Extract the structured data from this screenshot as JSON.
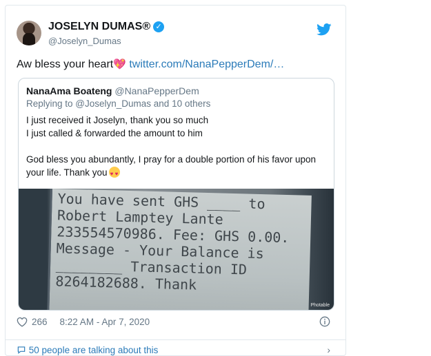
{
  "author": {
    "name": "JOSELYN DUMAS®",
    "handle": "@Joselyn_Dumas"
  },
  "tweet": {
    "text": "Aw bless your heart",
    "emoji": "sparkling-heart",
    "link": "twitter.com/NanaPepperDem/…"
  },
  "quote": {
    "name": "NanaAma Boateng",
    "handle": "@NanaPepperDem",
    "replying_to": "Replying to @Joselyn_Dumas and 10 others",
    "lines": [
      "I just received it Joselyn, thank you so much",
      "I just called & forwarded the amount to him",
      "God bless you abundantly, I pray for a double portion of his favor upon your life. Thank you"
    ],
    "photo_text": [
      "You have sent GHS ____ to",
      "Robert Lamptey Lante",
      "233554570986. Fee: GHS 0.00.",
      "Message - Your Balance is",
      "________ Transaction ID",
      "8264182688. Thank"
    ],
    "watermark": "Photable"
  },
  "stats": {
    "likes": "266",
    "timestamp": "8:22 AM - Apr 7, 2020"
  },
  "footer": {
    "talking": "50 people are talking about this"
  },
  "colors": {
    "link": "#2b7bb9",
    "verified": "#1da1f2",
    "muted": "#657786"
  }
}
